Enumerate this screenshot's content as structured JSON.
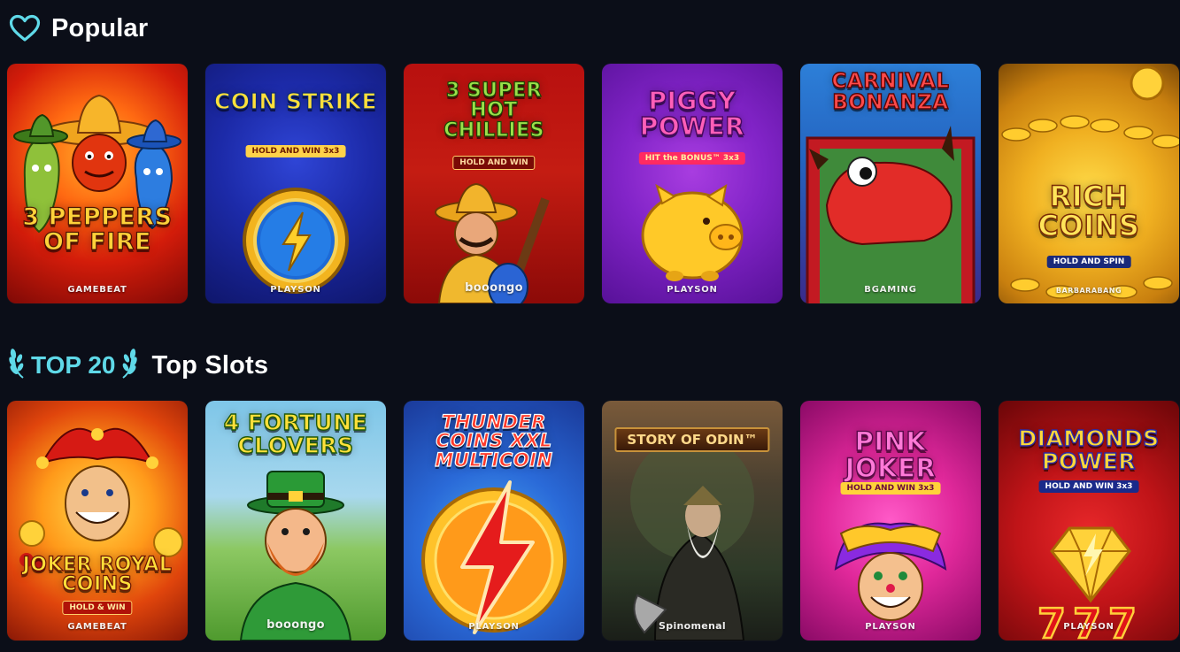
{
  "sections": [
    {
      "title": "Popular",
      "icon": "heart-icon",
      "games": [
        {
          "title": "3 PEPPERS OF FIRE",
          "subtitle": "",
          "provider": "GAMEBEAT"
        },
        {
          "title": "COIN STRIKE",
          "subtitle": "HOLD AND WIN 3x3",
          "provider": "PLAYSON"
        },
        {
          "title": "3 SUPER HOT CHILLIES",
          "subtitle": "HOLD AND WIN",
          "provider": "booongo"
        },
        {
          "title": "PIGGY POWER",
          "subtitle": "HIT the BONUS™ 3x3",
          "provider": "PLAYSON"
        },
        {
          "title": "CARNIVAL BONANZA",
          "subtitle": "",
          "provider": "BGAMING"
        },
        {
          "title": "RICH COINS",
          "subtitle": "HOLD AND SPIN",
          "provider": "BARBARABANG"
        }
      ]
    },
    {
      "title": "Top Slots",
      "icon": "laurel-icon",
      "badge": "TOP 20",
      "games": [
        {
          "title": "JOKER ROYAL COINS",
          "subtitle": "HOLD & WIN",
          "provider": "GAMEBEAT"
        },
        {
          "title": "4 FORTUNE CLOVERS",
          "subtitle": "",
          "provider": "booongo"
        },
        {
          "title": "THUNDER COINS XXL MULTICOIN",
          "subtitle": "",
          "provider": "PLAYSON"
        },
        {
          "title": "STORY OF ODIN™",
          "subtitle": "",
          "provider": "Spinomenal"
        },
        {
          "title": "PINK JOKER",
          "subtitle": "HOLD AND WIN 3x3",
          "provider": "PLAYSON"
        },
        {
          "title": "DIAMONDS POWER",
          "subtitle": "HOLD AND WIN 3x3",
          "provider": "PLAYSON"
        }
      ]
    }
  ],
  "colors": {
    "background": "#0b0e18",
    "accent": "#5fd9e8",
    "text": "#ffffff"
  }
}
